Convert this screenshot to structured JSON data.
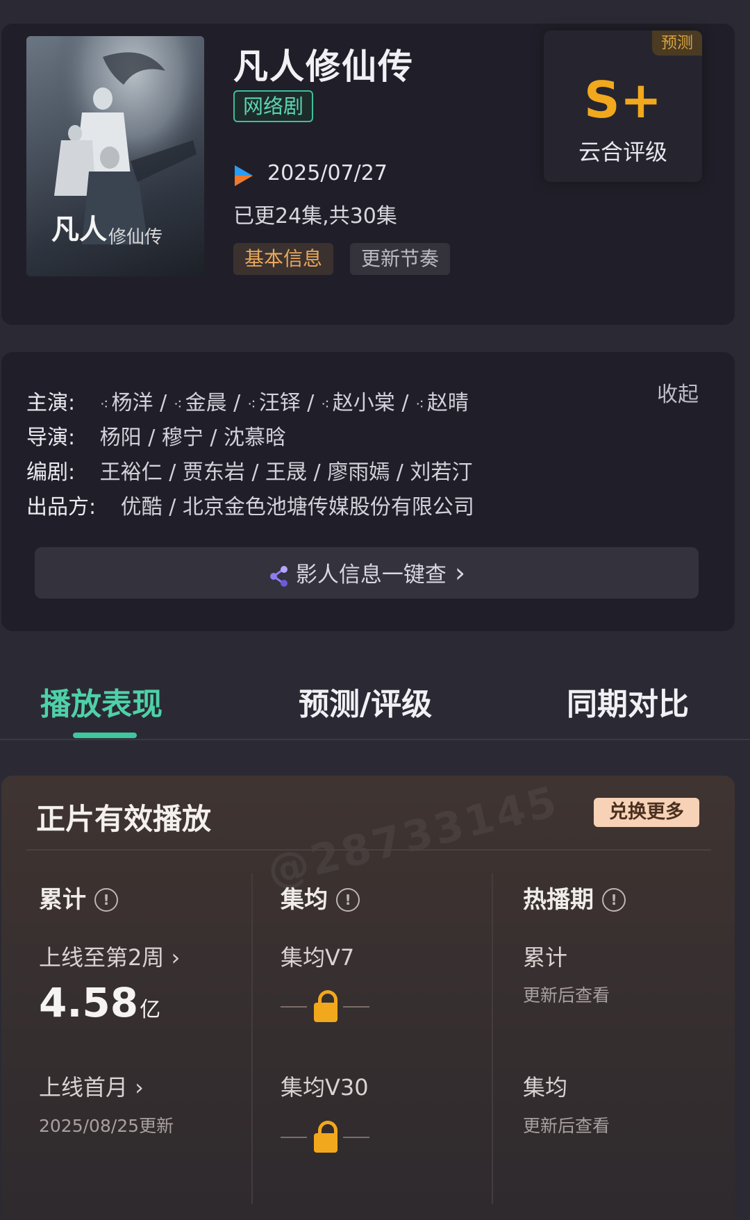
{
  "show": {
    "title": "凡人修仙传",
    "type": "网络剧",
    "date": "2025/07/27",
    "episodes": "已更24集,共30集",
    "tabs": [
      "基本信息",
      "更新节奏"
    ],
    "rating": {
      "tag": "预测",
      "grade": "S+",
      "label": "云合评级"
    },
    "platform_icon": "youku-icon"
  },
  "credits": {
    "cast_label": "主演:",
    "cast": [
      "杨洋",
      "金晨",
      "汪铎",
      "赵小棠",
      "赵晴"
    ],
    "director_label": "导演:",
    "directors": "杨阳 / 穆宁 / 沈慕晗",
    "writer_label": "编剧:",
    "writers": "王裕仁 / 贾东岩 / 王晟 / 廖雨嫣 / 刘若汀",
    "producer_label": "出品方:",
    "producers": "优酷 / 北京金色池塘传媒股份有限公司",
    "collapse": "收起",
    "people_button": "影人信息一键查",
    "people_chevron": "›"
  },
  "main_tabs": [
    "播放表现",
    "预测/评级",
    "同期对比"
  ],
  "play": {
    "title": "正片有效播放",
    "exchange": "兑换更多",
    "info_glyph": "!",
    "watermark": "@28733145",
    "col1": {
      "head": "累计",
      "row1_label": "上线至第2周 ›",
      "value": "4.58",
      "unit": "亿",
      "row2_label": "上线首月 ›",
      "row2_note": "2025/08/25更新"
    },
    "col2": {
      "head": "集均",
      "row1_label": "集均V7",
      "row2_label": "集均V30"
    },
    "col3": {
      "head": "热播期",
      "row1_label": "累计",
      "row1_note": "更新后查看",
      "row2_label": "集均",
      "row2_note": "更新后查看"
    }
  },
  "colors": {
    "accent_green": "#4ed1a8",
    "grade_gold": "#f2a81c",
    "background": "#2b2a34"
  }
}
